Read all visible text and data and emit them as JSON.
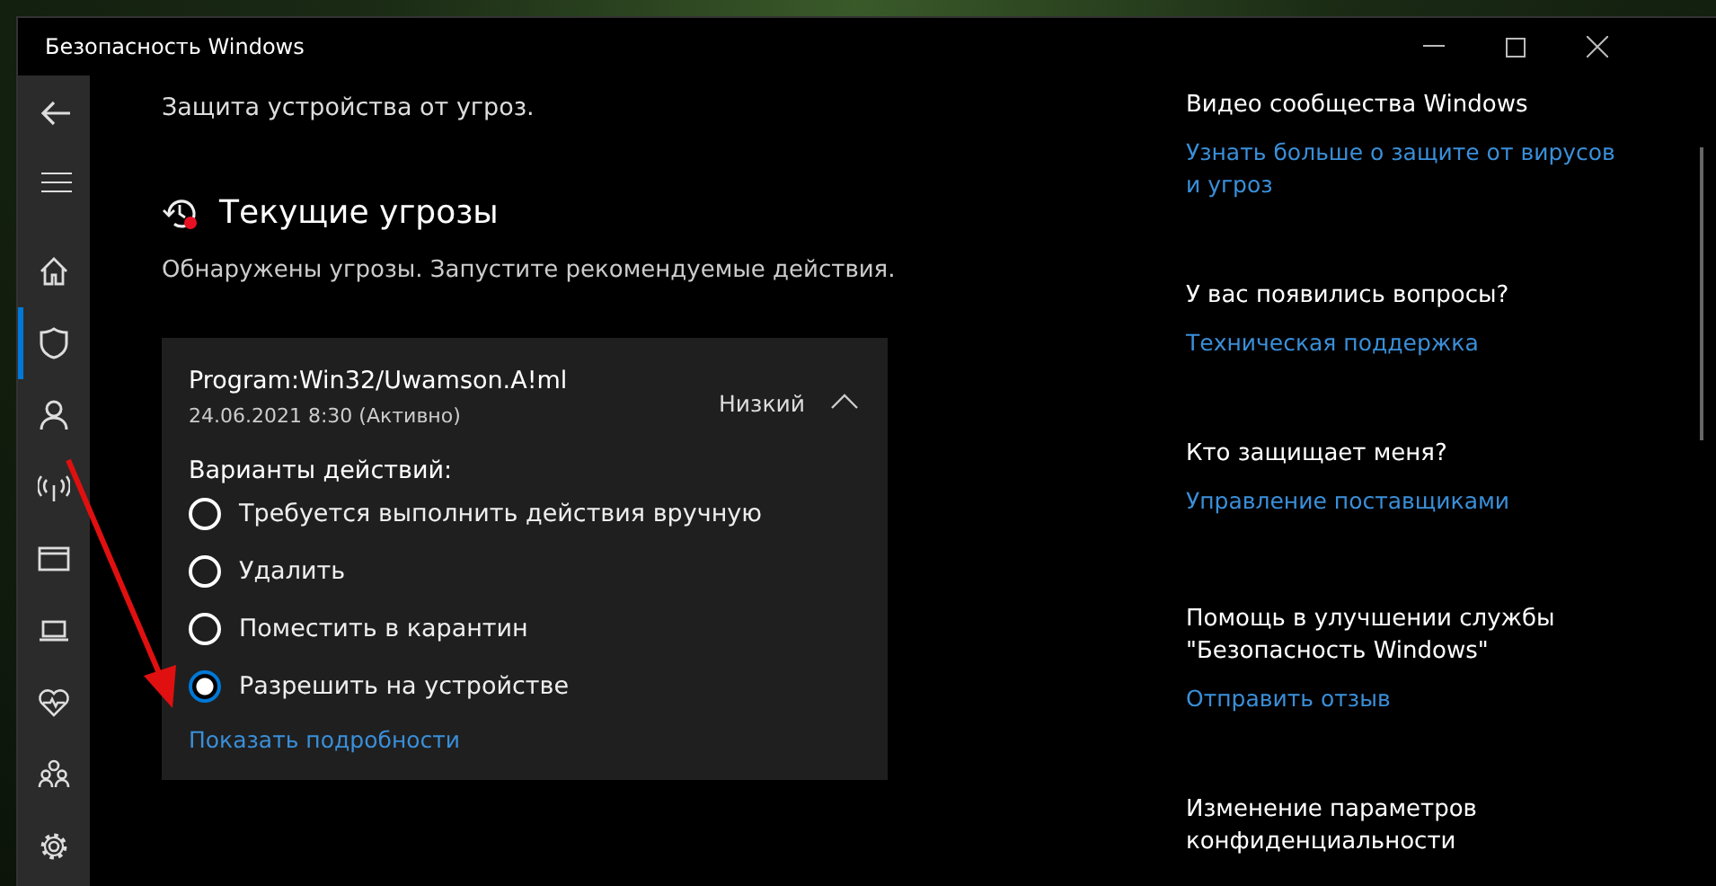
{
  "window": {
    "title": "Безопасность Windows"
  },
  "nav": [
    {
      "kind": "home",
      "selected": false
    },
    {
      "kind": "shield",
      "selected": true
    },
    {
      "kind": "person",
      "selected": false
    },
    {
      "kind": "wifi",
      "selected": false
    },
    {
      "kind": "browser",
      "selected": false
    },
    {
      "kind": "laptop",
      "selected": false
    },
    {
      "kind": "heart",
      "selected": false
    },
    {
      "kind": "family",
      "selected": false
    },
    {
      "kind": "gear",
      "selected": false
    }
  ],
  "content": {
    "intro": "Защита устройства от угроз.",
    "section_title": "Текущие угрозы",
    "section_description": "Обнаружены угрозы. Запустите рекомендуемые действия.",
    "threat": {
      "name": "Program:Win32/Uwamson.A!ml",
      "date": "24.06.2021 8:30 (Активно)",
      "severity": "Низкий",
      "expanded": true,
      "actions_label": "Варианты действий:",
      "options": [
        {
          "label": "Требуется выполнить действия вручную",
          "selected": false
        },
        {
          "label": "Удалить",
          "selected": false
        },
        {
          "label": "Поместить в карантин",
          "selected": false
        },
        {
          "label": "Разрешить на устройстве",
          "selected": true
        }
      ],
      "details_link": "Показать подробности"
    }
  },
  "side_panel": [
    {
      "heading": "Видео сообщества Windows",
      "link": "Узнать больше о защите от вирусов и угроз"
    },
    {
      "heading": "У вас появились вопросы?",
      "link": "Техническая поддержка"
    },
    {
      "heading": "Кто защищает меня?",
      "link": "Управление поставщиками"
    },
    {
      "heading": "Помощь в улучшении службы \"Безопасность Windows\"",
      "link": "Отправить отзыв"
    },
    {
      "heading": "Изменение параметров конфиденциальности"
    }
  ]
}
